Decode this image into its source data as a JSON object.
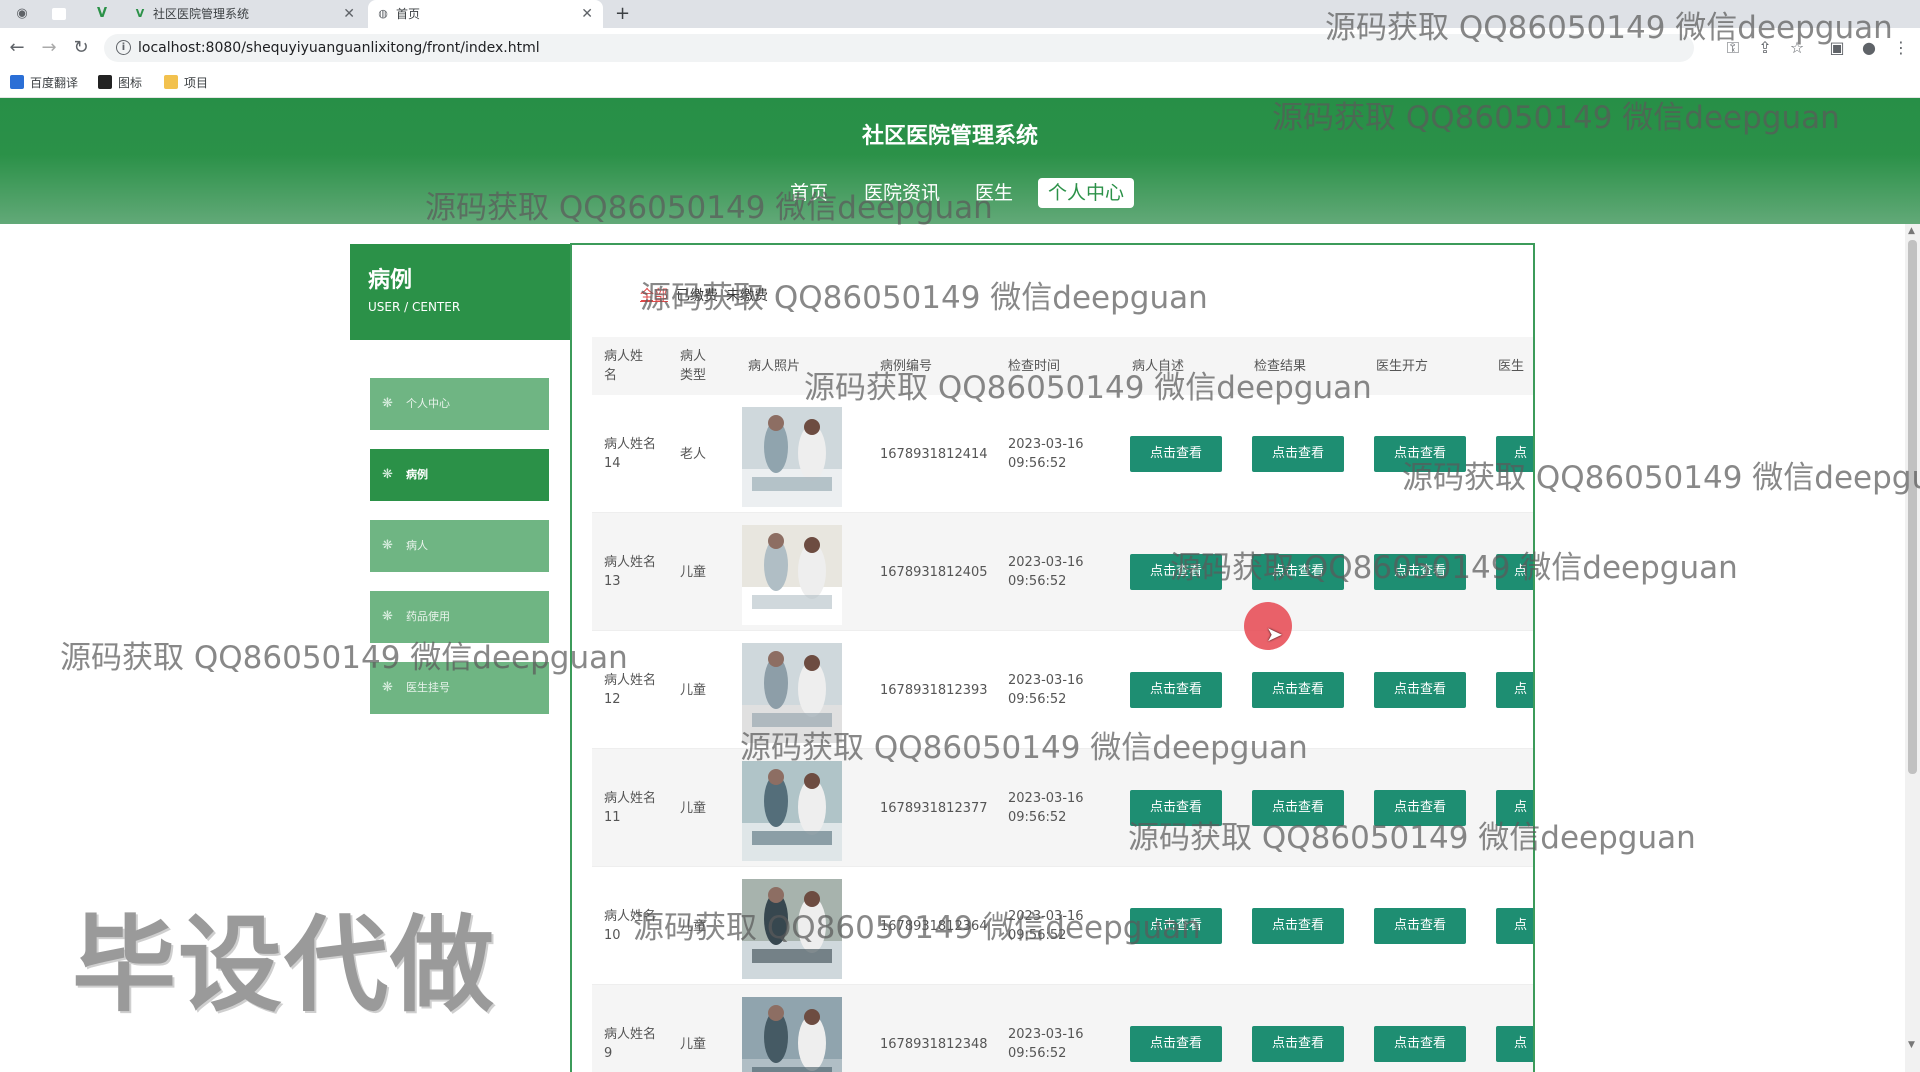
{
  "browser": {
    "tabs": [
      {
        "title": "社区医院管理系统",
        "icon": "vue-logo-icon"
      },
      {
        "title": "首页",
        "icon": "globe-icon"
      }
    ],
    "url": "localhost:8080/shequyiyuanguanlixitong/front/index.html",
    "bookmarks": [
      "百度翻译",
      "图标",
      "项目"
    ]
  },
  "header": {
    "title": "社区医院管理系统",
    "nav": [
      "首页",
      "医院资讯",
      "医生",
      "个人中心"
    ],
    "active_nav": "个人中心"
  },
  "sidebar": {
    "title": "病例",
    "subtitle": "USER / CENTER",
    "items": [
      {
        "label": "个人中心",
        "active": false
      },
      {
        "label": "病例",
        "active": true
      },
      {
        "label": "病人",
        "active": false
      },
      {
        "label": "药品使用",
        "active": false
      },
      {
        "label": "医生挂号",
        "active": false
      }
    ]
  },
  "filters": [
    "全部",
    "已缴费",
    "未缴费"
  ],
  "active_filter": "全部",
  "table": {
    "columns": [
      "病人姓名",
      "病人类型",
      "病人照片",
      "病例编号",
      "检查时间",
      "病人自述",
      "检查结果",
      "医生开方",
      "医生"
    ],
    "action_label": "点击查看",
    "truncated_action_label": "点",
    "rows": [
      {
        "name": "病人姓名14",
        "type": "老人",
        "number": "1678931812414",
        "date": "2023-03-16",
        "time": "09:56:52"
      },
      {
        "name": "病人姓名13",
        "type": "儿童",
        "number": "1678931812405",
        "date": "2023-03-16",
        "time": "09:56:52"
      },
      {
        "name": "病人姓名12",
        "type": "儿童",
        "number": "1678931812393",
        "date": "2023-03-16",
        "time": "09:56:52"
      },
      {
        "name": "病人姓名11",
        "type": "儿童",
        "number": "1678931812377",
        "date": "2023-03-16",
        "time": "09:56:52"
      },
      {
        "name": "病人姓名10",
        "type": "儿童",
        "number": "1678931812364",
        "date": "2023-03-16",
        "time": "09:56:52"
      },
      {
        "name": "病人姓名9",
        "type": "儿童",
        "number": "1678931812348",
        "date": "2023-03-16",
        "time": "09:56:52"
      }
    ]
  },
  "watermark": "源码获取 QQ86050149 微信deepguan",
  "big_watermark": "毕设代做",
  "colors": {
    "primary": "#2b9148",
    "button": "#1e8e72",
    "sidebar_item": "#6fb583",
    "filter_active": "#e04848"
  }
}
